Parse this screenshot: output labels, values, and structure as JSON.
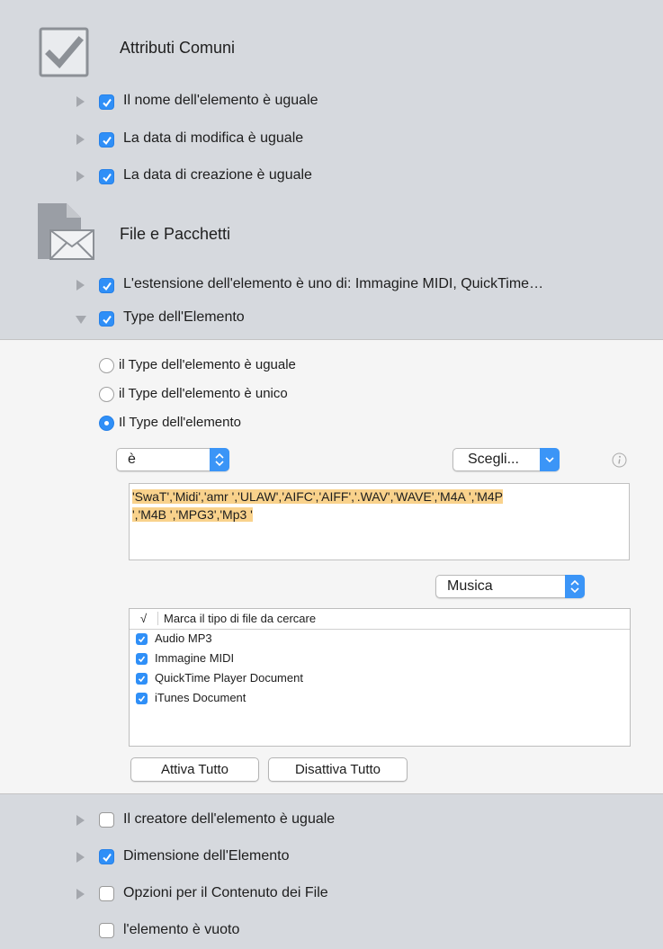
{
  "sections": {
    "common": {
      "title": "Attributi Comuni"
    },
    "files": {
      "title": "File e Pacchetti"
    }
  },
  "rules": {
    "name_equal": {
      "label": "Il nome dell'elemento è uguale",
      "checked": true
    },
    "modified_equal": {
      "label": "La data di modifica è uguale",
      "checked": true
    },
    "created_equal": {
      "label": "La data di creazione è uguale",
      "checked": true
    },
    "extension": {
      "label": "L'estensione dell'elemento è uno di: Immagine MIDI, QuickTime…",
      "checked": true
    },
    "type": {
      "label": "Type dell'Elemento",
      "checked": true,
      "expanded": true
    },
    "creator_equal": {
      "label": "Il creatore dell'elemento è uguale",
      "checked": false
    },
    "size": {
      "label": "Dimensione dell'Elemento",
      "checked": true
    },
    "content_options": {
      "label": "Opzioni per il Contenuto dei File",
      "checked": false
    },
    "empty": {
      "label": "l'elemento è vuoto",
      "checked": false
    }
  },
  "type_panel": {
    "radios": [
      {
        "label": "il Type dell'elemento è uguale",
        "selected": false
      },
      {
        "label": "il Type dell'elemento è unico",
        "selected": false
      },
      {
        "label": "Il Type dell'elemento",
        "selected": true
      }
    ],
    "operator_select": "è",
    "choose_button": "Scegli...",
    "types_line1": "'SwaT','Midi','amr ','ULAW','AIFC','AIFF','.WAV','WAVE','M4A ','M4P",
    "types_line2": "','M4B ','MPG3','Mp3 '",
    "category_select": "Musica",
    "list_header_check": "√",
    "list_header_title": "Marca il tipo di file da cercare",
    "file_types": [
      {
        "label": "Audio MP3",
        "checked": true
      },
      {
        "label": "Immagine MIDI",
        "checked": true
      },
      {
        "label": "QuickTime Player Document",
        "checked": true
      },
      {
        "label": "iTunes Document",
        "checked": true
      }
    ],
    "enable_all": "Attiva Tutto",
    "disable_all": "Disattiva Tutto"
  },
  "icons": {
    "common": "checkbox-large-icon",
    "files": "document-envelope-icon",
    "info": "info-icon"
  },
  "colors": {
    "accent": "#2f8ff7",
    "background": "#d6d9de",
    "panel": "#f5f5f5",
    "highlight": "#f9d28c"
  }
}
